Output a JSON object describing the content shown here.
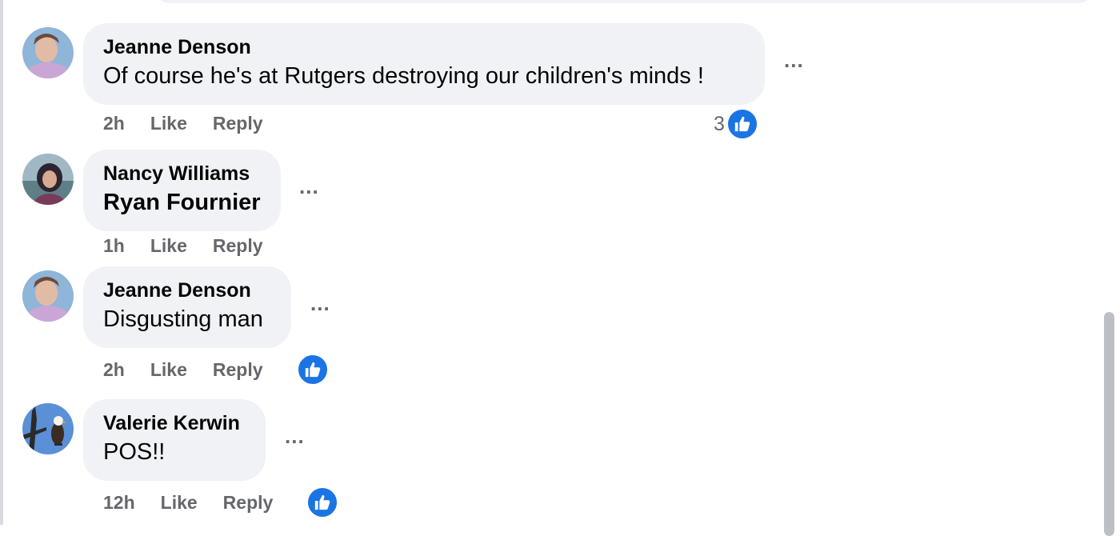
{
  "comments": [
    {
      "author": "Jeanne Denson",
      "text": "Of course he's at Rutgers destroying our children's minds !",
      "time": "2h",
      "like_label": "Like",
      "reply_label": "Reply",
      "reaction_count": "3",
      "reaction_icon": "like-icon",
      "avatar_icon": "profile-photo"
    },
    {
      "author": "Nancy Williams",
      "text": "Ryan Fournier",
      "time": "1h",
      "like_label": "Like",
      "reply_label": "Reply",
      "avatar_icon": "profile-photo"
    },
    {
      "author": "Jeanne Denson",
      "text": "Disgusting man",
      "time": "2h",
      "like_label": "Like",
      "reply_label": "Reply",
      "reaction_icon": "like-icon",
      "avatar_icon": "profile-photo"
    },
    {
      "author": "Valerie Kerwin",
      "text": "POS!!",
      "time": "12h",
      "like_label": "Like",
      "reply_label": "Reply",
      "reaction_icon": "like-icon",
      "avatar_icon": "eagle-photo"
    }
  ],
  "more_options_glyph": "...",
  "colors": {
    "bubble": "#f0f2f5",
    "meta_text": "#65676b",
    "like_blue": "#1b74e4"
  }
}
